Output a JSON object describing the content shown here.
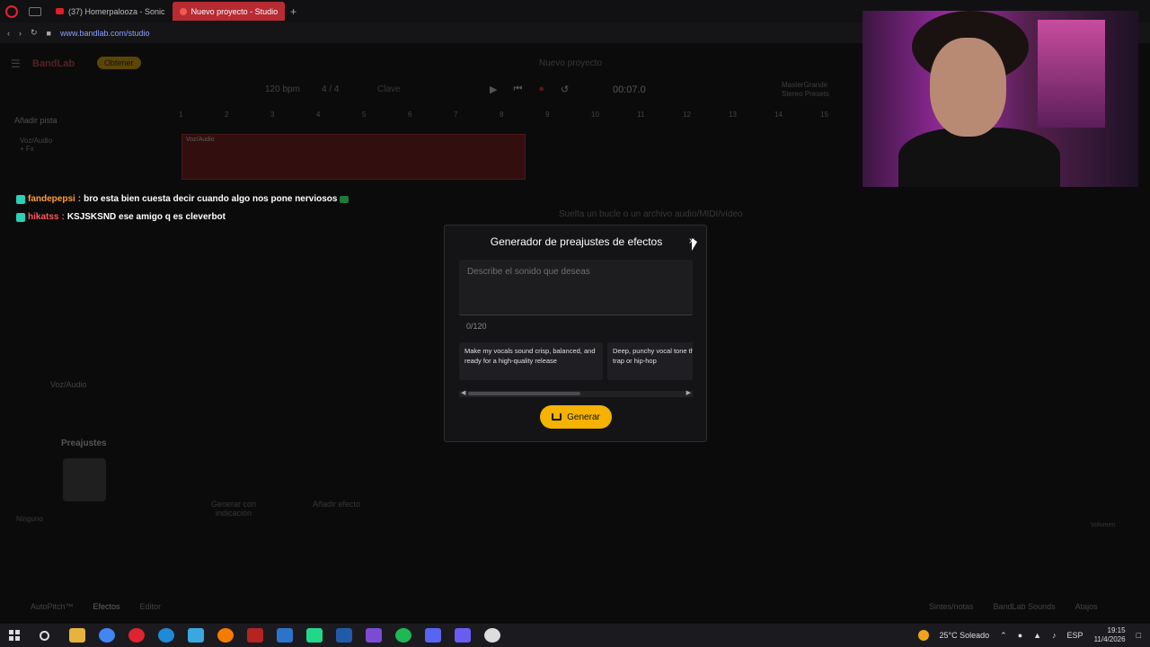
{
  "browser": {
    "tabs": [
      {
        "label": "(37) Homerpalooza - Sonic"
      },
      {
        "label": "Nuevo proyecto - Studio"
      }
    ],
    "url": "www.bandlab.com/studio"
  },
  "studio": {
    "logo": "BandLab",
    "obtener": "Obtener",
    "project_title": "Nuevo proyecto",
    "tempo": "120 bpm",
    "time_signature": "4 / 4",
    "key": "Clave",
    "time": "00:07.0",
    "master_label": "MasterGrande",
    "master_sub": "Stereo Presets",
    "add_track": "Añadir pista",
    "ruler": [
      "1",
      "2",
      "3",
      "4",
      "5",
      "6",
      "7",
      "8",
      "9",
      "10",
      "11",
      "12",
      "13",
      "14",
      "15"
    ],
    "track_name": "Voz/Audio",
    "track_fx": "+ Fx",
    "region_label": "Voz/Audio",
    "drop_hint": "Suelta un bucle o un archivo audio/MIDI/vídeo",
    "panel_title": "Voz/Audio",
    "preajustes": "Preajustes",
    "ninguno": "Ninguno",
    "generar_indicacion": "Generar con indicación",
    "anadir_efecto": "Añadir efecto",
    "volumen": "Volumen",
    "bottom_tabs": [
      "AutoPitch™",
      "Efectos",
      "Editor"
    ],
    "bottom_right": [
      "Sintes/notas",
      "BandLab Sounds",
      "Atajos"
    ]
  },
  "chat": [
    {
      "user": "fandepepsi",
      "message": "bro esta bien cuesta decir cuando algo nos pone nerviosos"
    },
    {
      "user": "hikatss",
      "message": "KSJSKSND ese amigo q es cleverbot"
    }
  ],
  "modal": {
    "title": "Generador de preajustes de efectos",
    "close": "×",
    "placeholder": "Describe el sonido que deseas",
    "counter": "0/120",
    "suggestions": [
      "Make my vocals sound crisp, balanced, and ready for a high-quality release",
      "Deep, punchy vocal tone through a hard trap or hip-hop"
    ],
    "generate_label": "Generar"
  },
  "taskbar": {
    "weather": "25°C  Soleado",
    "lang": "ESP",
    "time": "19:15",
    "date": "11/4/2026"
  },
  "colors": {
    "accent": "#f5b300",
    "region": "#7a1616",
    "tab_active": "#b72b32"
  }
}
